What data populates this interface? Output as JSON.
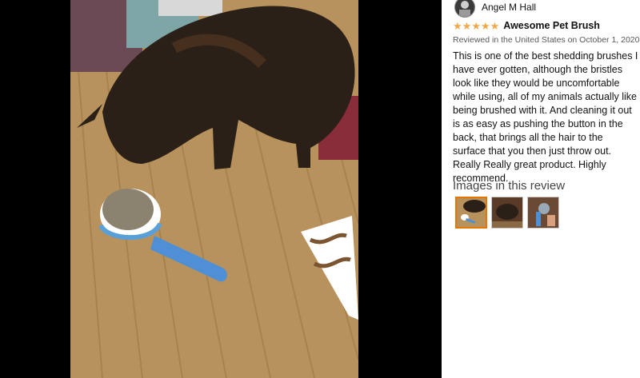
{
  "review": {
    "reviewer_name": "Angel M Hall",
    "rating": 5,
    "title": "Awesome Pet Brush",
    "meta": "Reviewed in the United States on October 1, 2020",
    "body": "This is one of the best shedding brushes I have ever gotten, although the bristles look like they would be uncomfortable while using, all of my animals actually like being brushed with it. And cleaning it out is as easy as pushing the button in the back, that brings all the hair to the surface that you then just throw out. Really Really great product. Highly recommend."
  },
  "images_section": {
    "heading": "Images in this review",
    "thumbnails": [
      {
        "name": "thumbnail-1",
        "selected": true
      },
      {
        "name": "thumbnail-2",
        "selected": false
      },
      {
        "name": "thumbnail-3",
        "selected": false
      }
    ]
  },
  "colors": {
    "star": "#f3a847",
    "selected_border": "#e77600"
  },
  "icons": [
    "star-icon",
    "avatar"
  ]
}
